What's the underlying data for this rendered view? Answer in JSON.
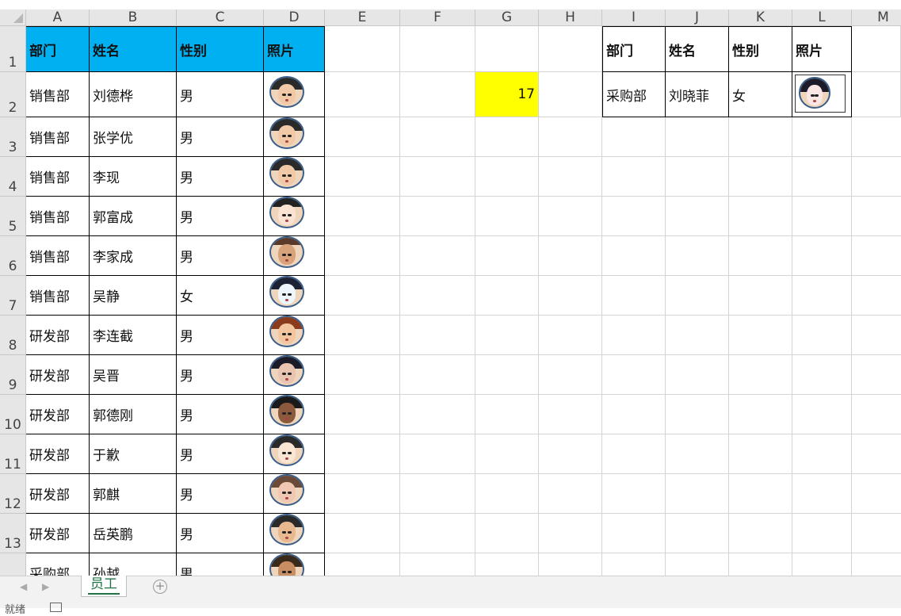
{
  "columns": [
    "A",
    "B",
    "C",
    "D",
    "E",
    "F",
    "G",
    "H",
    "I",
    "J",
    "K",
    "L",
    "M"
  ],
  "rows": [
    "1",
    "2",
    "3",
    "4",
    "5",
    "6",
    "7",
    "8",
    "9",
    "10",
    "11",
    "12",
    "13",
    ""
  ],
  "table_main": {
    "header": {
      "dept": "部门",
      "name": "姓名",
      "gender": "性别",
      "photo": "照片"
    },
    "records": [
      {
        "dept": "销售部",
        "name": "刘德桦",
        "gender": "男"
      },
      {
        "dept": "销售部",
        "name": "张学优",
        "gender": "男"
      },
      {
        "dept": "销售部",
        "name": "李现",
        "gender": "男"
      },
      {
        "dept": "销售部",
        "name": "郭富成",
        "gender": "男"
      },
      {
        "dept": "销售部",
        "name": "李家成",
        "gender": "男"
      },
      {
        "dept": "销售部",
        "name": "吴静",
        "gender": "女"
      },
      {
        "dept": "研发部",
        "name": "李连截",
        "gender": "男"
      },
      {
        "dept": "研发部",
        "name": "吴晋",
        "gender": "男"
      },
      {
        "dept": "研发部",
        "name": "郭德刚",
        "gender": "男"
      },
      {
        "dept": "研发部",
        "name": "于歉",
        "gender": "男"
      },
      {
        "dept": "研发部",
        "name": "郭麒",
        "gender": "男"
      },
      {
        "dept": "研发部",
        "name": "岳英鹏",
        "gender": "男"
      },
      {
        "dept": "采购部",
        "name": "孙越",
        "gender": "男"
      }
    ]
  },
  "g2_value": "17",
  "lookup": {
    "header": {
      "dept": "部门",
      "name": "姓名",
      "gender": "性别",
      "photo": "照片"
    },
    "record": {
      "dept": "采购部",
      "name": "刘晓菲",
      "gender": "女"
    }
  },
  "sheet_tabs": [
    "员工"
  ],
  "status": {
    "ready_text": "就绪"
  },
  "colors": {
    "header_blue": "#00b0f0",
    "highlight_yellow": "#ffff00",
    "tab_green": "#217346"
  }
}
